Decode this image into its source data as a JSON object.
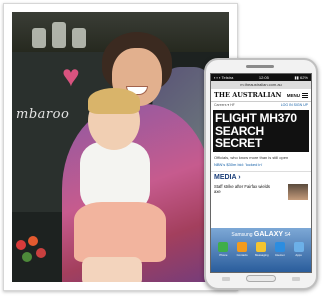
{
  "photo": {
    "chalkboard_text": "mbaroo"
  },
  "phone": {
    "status": {
      "left": "▪ ▪ ▪ Telstra",
      "time": "12:05",
      "right": "▮▮ 62%"
    },
    "url": "m.theaustralian.com.au",
    "masthead": {
      "brand": "THE AUSTRALIAN",
      "menu_label": "MENU"
    },
    "subnav": {
      "left": "Careers ▾  HF",
      "login": "LOG IN",
      "signup": "SIGN UP"
    },
    "headline": "FLIGHT MH370 SEARCH SECRET",
    "story_1": "Officials, who know more than is still open",
    "story_2": "NBN's $30m bid: 'locked in'",
    "section_label": "MEDIA ›",
    "media_item": "Staff strike after Fairfax wields axe",
    "ad": {
      "brand": "Samsung",
      "product": "GALAXY",
      "model": "S4",
      "icons": [
        "Phone",
        "Contacts",
        "Messaging",
        "Internet",
        "Apps"
      ],
      "icon_colors": [
        "#3fae49",
        "#f29b1d",
        "#f4c430",
        "#2c8de0",
        "#6cb0e8"
      ]
    }
  }
}
